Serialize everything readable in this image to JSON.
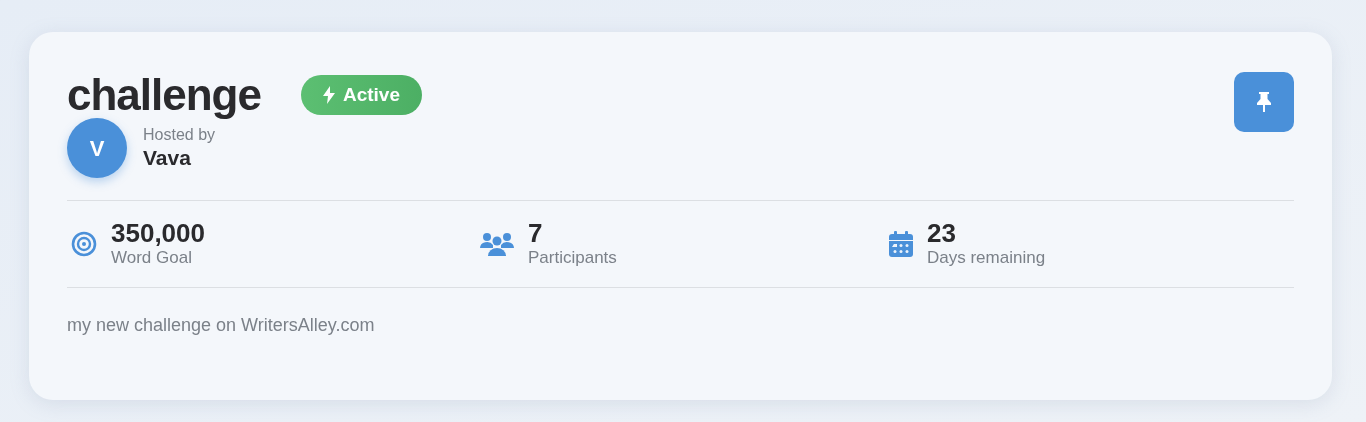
{
  "title": "challenge",
  "status": {
    "label": "Active",
    "kind": "active"
  },
  "host": {
    "initial": "V",
    "caption": "Hosted by",
    "name": "Vava"
  },
  "stats": [
    {
      "kind": "goal",
      "value": "350,000",
      "label": "Word Goal"
    },
    {
      "kind": "participants",
      "value": "7",
      "label": "Participants"
    },
    {
      "kind": "days",
      "value": "23",
      "label": "Days remaining"
    }
  ],
  "description": "my new challenge on WritersAlley.com"
}
